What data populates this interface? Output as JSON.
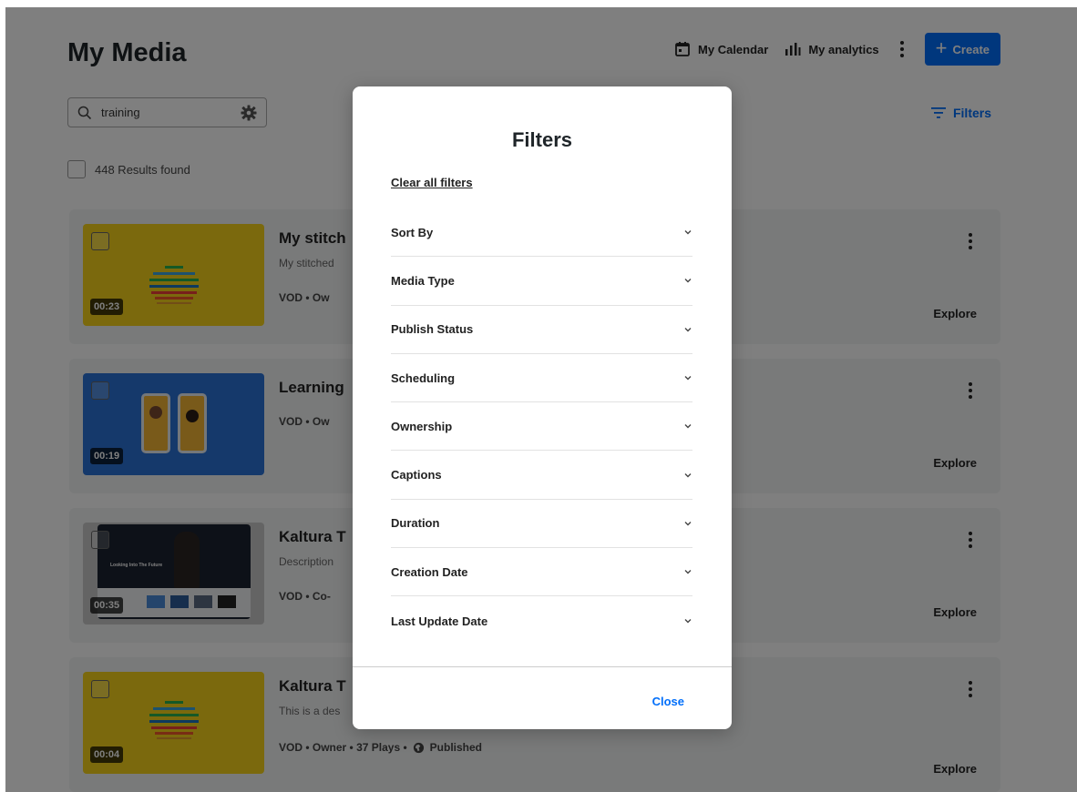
{
  "page": {
    "title": "My Media"
  },
  "header": {
    "calendar_label": "My Calendar",
    "analytics_label": "My analytics",
    "create_label": "Create"
  },
  "search": {
    "value": "training"
  },
  "filters_link": {
    "label": "Filters"
  },
  "results": {
    "label": "448 Results found"
  },
  "cards": [
    {
      "title": "My stitch",
      "desc": "My stitched",
      "meta": "VOD • Ow",
      "duration": "00:23",
      "explore": "Explore"
    },
    {
      "title": "Learning",
      "desc": "",
      "meta": "VOD • Ow",
      "duration": "00:19",
      "explore": "Explore"
    },
    {
      "title": "Kaltura T",
      "desc": "Description",
      "meta": "VOD • Co-",
      "duration": "00:35",
      "explore": "Explore",
      "thumb_text": "Looking Into The Future"
    },
    {
      "title": "Kaltura T",
      "desc": "This is a des",
      "meta": "VOD • Owner • 37 Plays •",
      "meta_status": "Published",
      "duration": "00:04",
      "explore": "Explore"
    }
  ],
  "modal": {
    "title": "Filters",
    "clear_all": "Clear all filters",
    "filters": [
      "Sort By",
      "Media Type",
      "Publish Status",
      "Scheduling",
      "Ownership",
      "Captions",
      "Duration",
      "Creation Date",
      "Last Update Date"
    ],
    "close_label": "Close"
  },
  "colors": {
    "accent": "#006efa",
    "thumb_yellow": "#f6d31a",
    "thumb_blue": "#2a72d6"
  }
}
